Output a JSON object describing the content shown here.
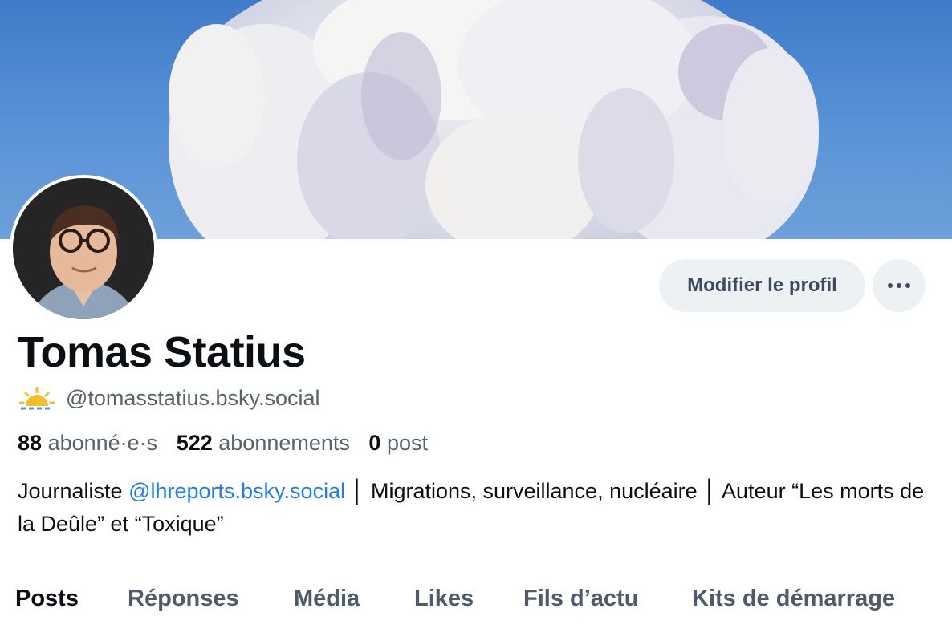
{
  "profile": {
    "display_name": "Tomas Statius",
    "handle": "@tomasstatius.bsky.social",
    "handle_icon": "sun-cloud-emoji-icon",
    "banner_description_icon": "cloud-painting-banner",
    "edit_profile_label": "Modifier le profil",
    "more_icon": "ellipsis-icon"
  },
  "stats": {
    "followers_count": "88",
    "followers_label": "abonné·e·s",
    "following_count": "522",
    "following_label": "abonnements",
    "posts_count": "0",
    "posts_label": "post"
  },
  "bio": {
    "prefix": "Journaliste ",
    "mention": "@lhreports.bsky.social",
    "rest": " │ Migrations, surveillance, nucléaire │ Auteur “Les morts de la Deûle” et “Toxique”"
  },
  "tabs": [
    {
      "label": "Posts",
      "active": true
    },
    {
      "label": "Réponses",
      "active": false
    },
    {
      "label": "Média",
      "active": false
    },
    {
      "label": "Likes",
      "active": false
    },
    {
      "label": "Fils d’actu",
      "active": false
    },
    {
      "label": "Kits de démarrage",
      "active": false
    }
  ],
  "colors": {
    "accent": "#1d7cf2",
    "muted_text": "#58616e",
    "button_bg": "#eef1f4",
    "banner_sky": "#4a86cf"
  }
}
